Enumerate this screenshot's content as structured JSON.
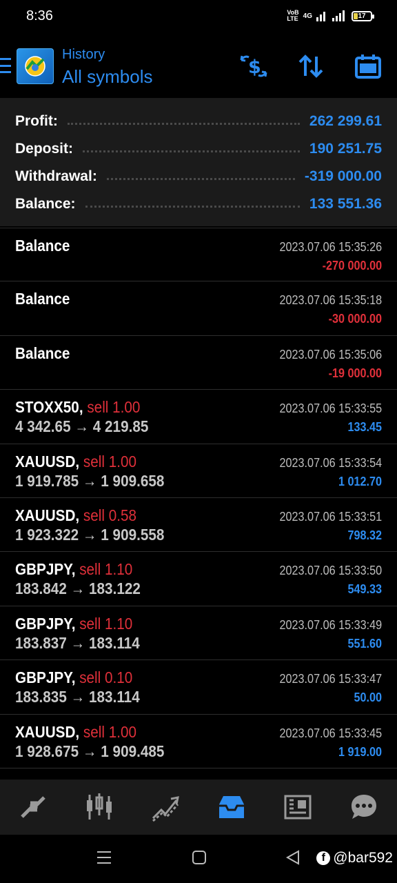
{
  "status_bar": {
    "time": "8:36",
    "network_top": "VoB",
    "network_bottom": "LTE",
    "network_type": "4G",
    "battery": "17"
  },
  "header": {
    "subtitle": "History",
    "title": "All symbols",
    "actions": [
      "currency-swap-icon",
      "sort-icon",
      "calendar-icon"
    ]
  },
  "summary": {
    "profit_label": "Profit:",
    "profit_value": "262 299.61",
    "deposit_label": "Deposit:",
    "deposit_value": "190 251.75",
    "withdrawal_label": "Withdrawal:",
    "withdrawal_value": "-319 000.00",
    "balance_label": "Balance:",
    "balance_value": "133 551.36"
  },
  "rows": [
    {
      "symbol": "Balance",
      "side": "",
      "prices": "",
      "time": "2023.07.06 15:35:26",
      "amount": "-270 000.00",
      "sign": "neg"
    },
    {
      "symbol": "Balance",
      "side": "",
      "prices": "",
      "time": "2023.07.06 15:35:18",
      "amount": "-30 000.00",
      "sign": "neg"
    },
    {
      "symbol": "Balance",
      "side": "",
      "prices": "",
      "time": "2023.07.06 15:35:06",
      "amount": "-19 000.00",
      "sign": "neg"
    },
    {
      "symbol": "STOXX50,",
      "side": "sell 1.00",
      "prices": "4 342.65 → 4 219.85",
      "time": "2023.07.06 15:33:55",
      "amount": "133.45",
      "sign": "pos"
    },
    {
      "symbol": "XAUUSD,",
      "side": "sell 1.00",
      "prices": "1 919.785 → 1 909.658",
      "time": "2023.07.06 15:33:54",
      "amount": "1 012.70",
      "sign": "pos"
    },
    {
      "symbol": "XAUUSD,",
      "side": "sell 0.58",
      "prices": "1 923.322 → 1 909.558",
      "time": "2023.07.06 15:33:51",
      "amount": "798.32",
      "sign": "pos"
    },
    {
      "symbol": "GBPJPY,",
      "side": "sell 1.10",
      "prices": "183.842 → 183.122",
      "time": "2023.07.06 15:33:50",
      "amount": "549.33",
      "sign": "pos"
    },
    {
      "symbol": "GBPJPY,",
      "side": "sell 1.10",
      "prices": "183.837 → 183.114",
      "time": "2023.07.06 15:33:49",
      "amount": "551.60",
      "sign": "pos"
    },
    {
      "symbol": "GBPJPY,",
      "side": "sell 0.10",
      "prices": "183.835 → 183.114",
      "time": "2023.07.06 15:33:47",
      "amount": "50.00",
      "sign": "pos"
    },
    {
      "symbol": "XAUUSD,",
      "side": "sell 1.00",
      "prices": "1 928.675 → 1 909.485",
      "time": "2023.07.06 15:33:45",
      "amount": "1 919.00",
      "sign": "pos"
    }
  ],
  "bottom_nav": [
    "quotes-icon",
    "chart-icon",
    "trade-icon",
    "history-icon",
    "news-icon",
    "chat-icon"
  ],
  "active_nav": "history-icon",
  "watermark": "@bar592",
  "colors": {
    "accent": "#2d8cf0",
    "negative": "#e0303a",
    "panel": "#1b1b1b"
  }
}
